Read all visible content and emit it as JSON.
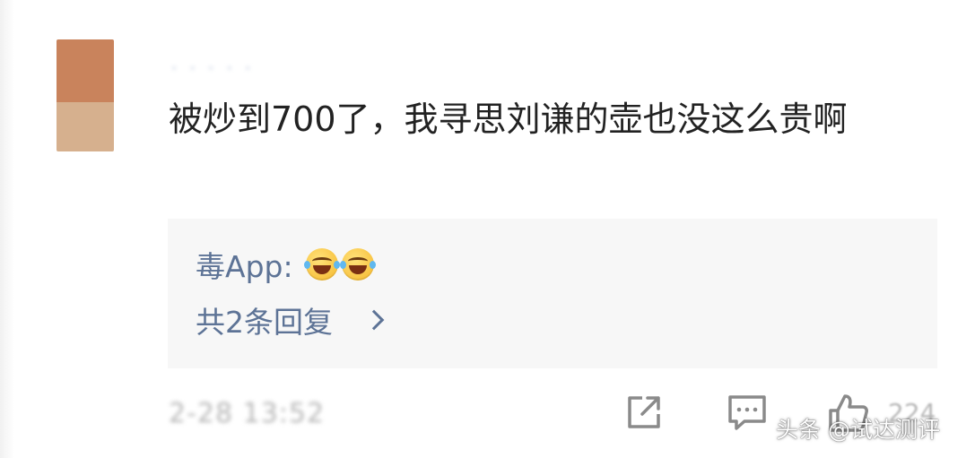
{
  "comment": {
    "username": "· · · · ·",
    "text": "被炒到700了，我寻思刘谦的壶也没这么贵啊",
    "timestamp": "2-28 13:52",
    "like_count": "224"
  },
  "reply": {
    "user": "毒App:",
    "emojis": [
      "laugh-cry-emoji",
      "laugh-cry-emoji"
    ],
    "more_label": "共2条回复"
  },
  "actions": {
    "icons": [
      "share-icon",
      "comment-icon",
      "like-icon"
    ]
  },
  "watermark": "头条 @试达测评",
  "colors": {
    "link": "#5d7396",
    "text": "#222222",
    "reply_bg": "#f7f7f7",
    "muted": "#b5b5b5"
  }
}
